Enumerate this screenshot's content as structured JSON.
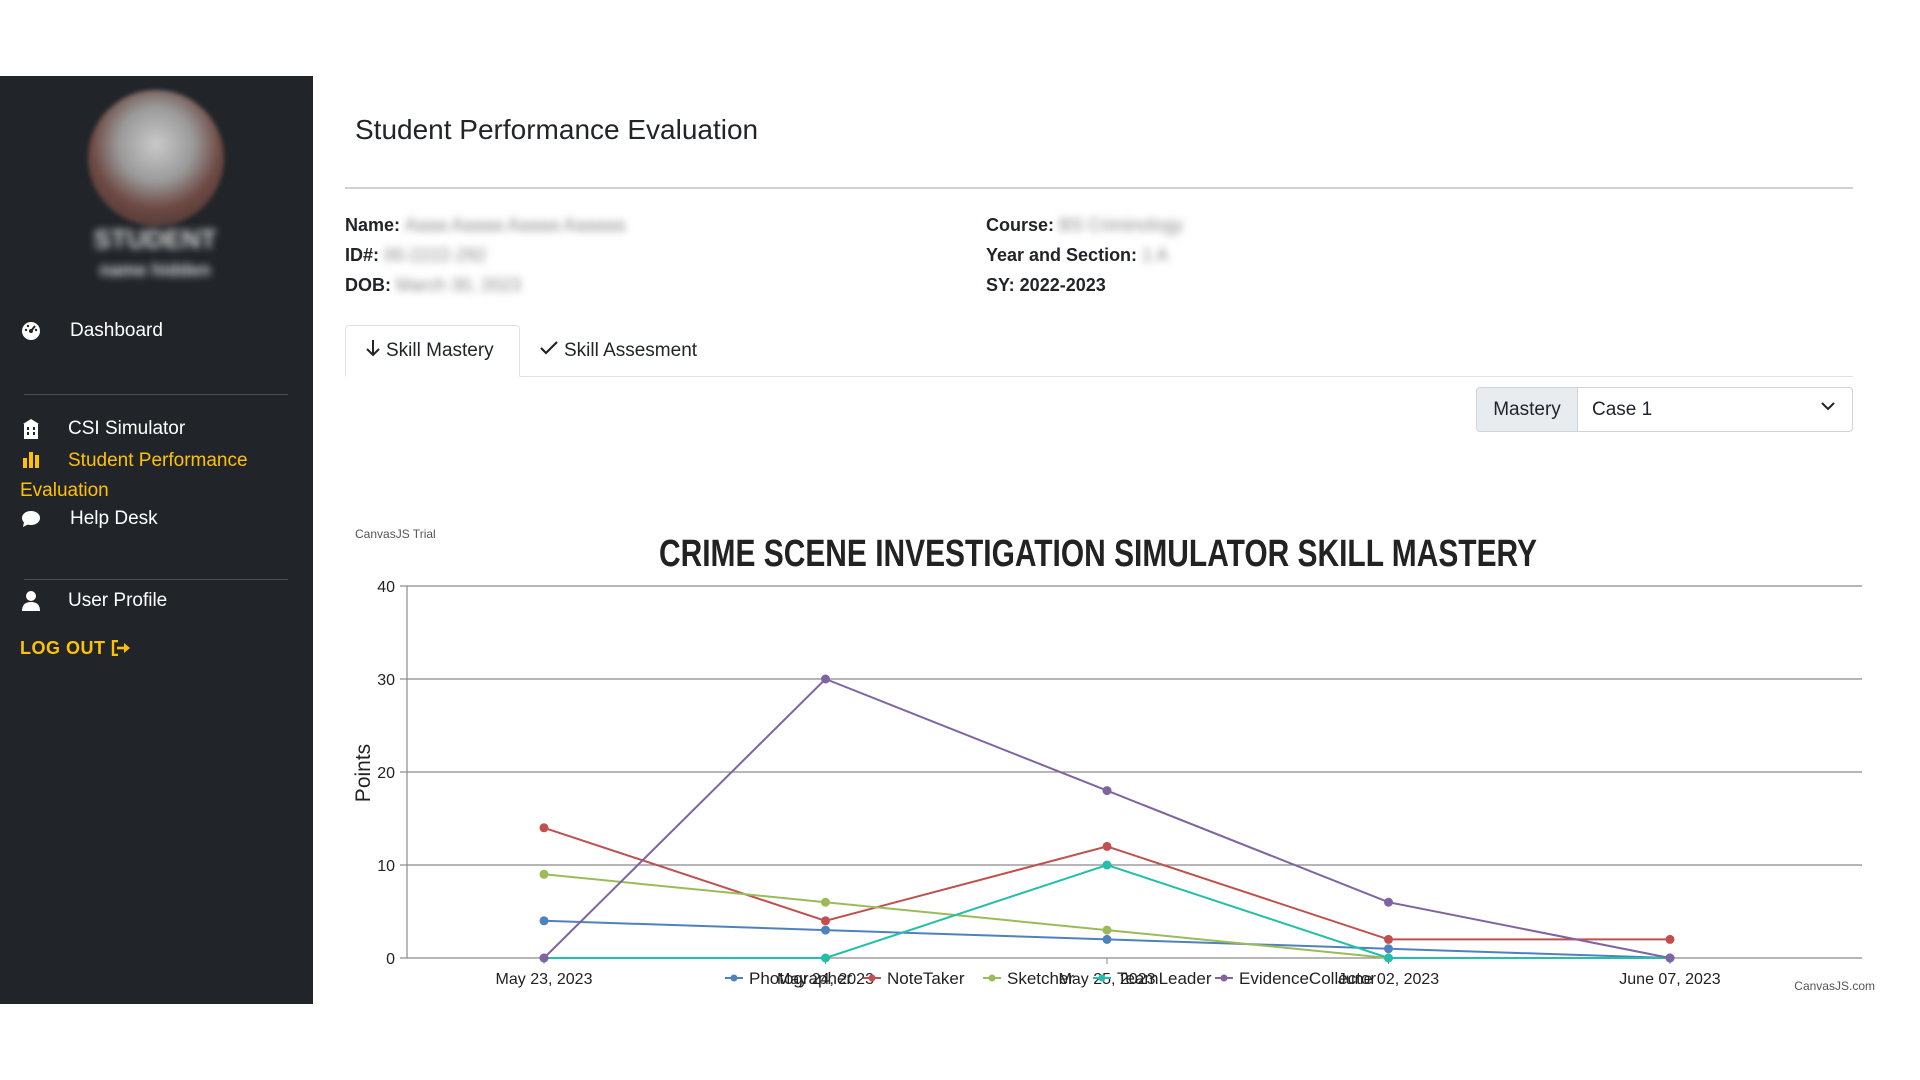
{
  "sidebar": {
    "role": "STUDENT",
    "role_sub": "name hidden",
    "items": [
      {
        "label": "Dashboard",
        "icon": "dashboard-icon"
      },
      {
        "label": "CSI Simulator",
        "icon": "building-icon"
      },
      {
        "label": "Student Performance Evaluation",
        "icon": "bar-chart-icon",
        "active": true
      },
      {
        "label": "Help Desk",
        "icon": "chat-icon"
      },
      {
        "label": "User Profile",
        "icon": "user-icon"
      }
    ],
    "logout_label": "LOG OUT"
  },
  "main": {
    "title": "Student Performance Evaluation",
    "student": {
      "name_label": "Name:",
      "name_value": "Aaaa Aaaaa Aaaaa Aaaaaa",
      "id_label": "ID#:",
      "id_value": "00-2222-292",
      "dob_label": "DOB:",
      "dob_value": "March 30, 2023",
      "course_label": "Course:",
      "course_value": "BS Criminology",
      "year_label": "Year and Section:",
      "year_value": "1 A",
      "sy_label": "SY: 2022-2023"
    },
    "tabs": [
      {
        "label": "Skill Mastery",
        "active": true
      },
      {
        "label": "Skill Assesment",
        "active": false
      }
    ],
    "select": {
      "label": "Mastery",
      "value": "Case 1"
    }
  },
  "colors": {
    "sidebar_bg": "#212529",
    "accent": "#ffc107",
    "Photographer": "#4f81bc",
    "NoteTaker": "#c0504e",
    "Sketcher": "#9bbb58",
    "TeamLeader": "#23bfaa",
    "EvidenceCollector": "#8064a1"
  },
  "chart_data": {
    "type": "line",
    "title": "CRIME SCENE INVESTIGATION SIMULATOR SKILL MASTERY",
    "watermark": "CanvasJS Trial",
    "credit": "CanvasJS.com",
    "ylabel": "Points",
    "xlabel": "",
    "ylim": [
      0,
      40
    ],
    "yticks": [
      0,
      10,
      20,
      30,
      40
    ],
    "grid": true,
    "legend_position": "bottom",
    "categories": [
      "May 23, 2023",
      "May 24, 2023",
      "May 25, 2023",
      "June 02, 2023",
      "June 07, 2023"
    ],
    "series": [
      {
        "name": "Photographer",
        "values": [
          4,
          3,
          2,
          1,
          0
        ]
      },
      {
        "name": "NoteTaker",
        "values": [
          14,
          4,
          12,
          2,
          2
        ]
      },
      {
        "name": "Sketcher",
        "values": [
          9,
          6,
          3,
          0,
          null
        ]
      },
      {
        "name": "TeamLeader",
        "values": [
          0,
          0,
          10,
          0,
          0
        ]
      },
      {
        "name": "EvidenceCollector",
        "values": [
          0,
          30,
          18,
          6,
          0
        ]
      }
    ]
  }
}
